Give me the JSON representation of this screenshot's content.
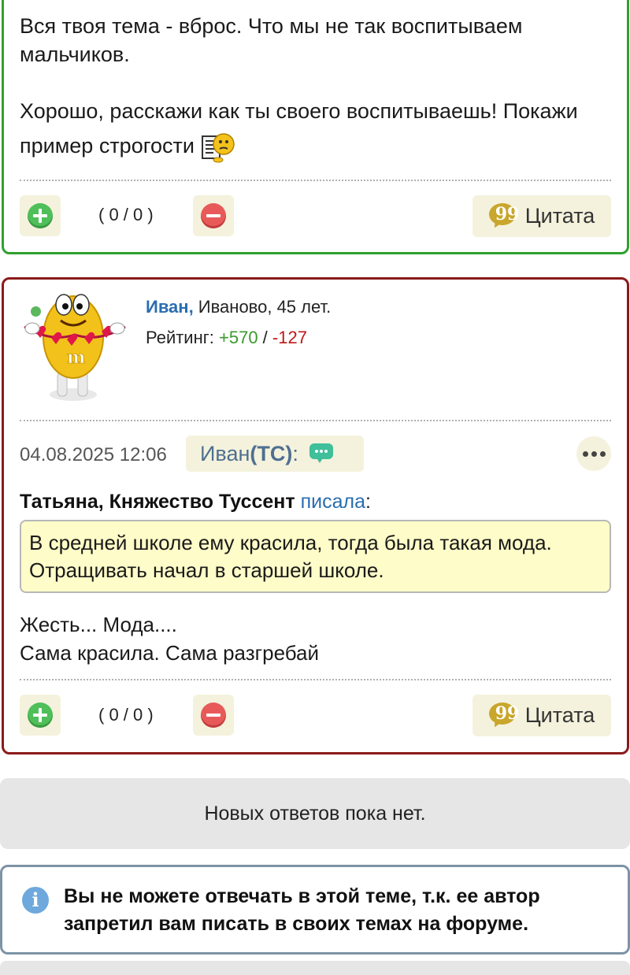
{
  "post_top": {
    "text_line1": "Вся твоя тема - вброс. Что мы не так воспитываем",
    "text_line2": "мальчиков.",
    "text_line3": "Хорошо, расскажи как ты своего воспитываешь! Покажи",
    "text_line4": "пример строгости",
    "emoji_icon": "reading-newspaper-emoji-icon",
    "votes": "( 0 / 0 )",
    "quote_label": "Цитата"
  },
  "post_ivan": {
    "author_name": "Иван,",
    "author_meta": " Иваново, 45 лет.",
    "rating_label": "Рейтинг: ",
    "rating_plus": "+570",
    "rating_sep": " / ",
    "rating_minus": "-127",
    "date": "04.08.2025 12:06",
    "chip_name": "Иван ",
    "chip_tag": "(ТС)",
    "chip_colon": ":",
    "quoted_author": "Татьяна, Княжество Туссент",
    "quoted_wrote": "писала",
    "quoted_colon": ":",
    "quote_line1": "В средней школе ему красила, тогда была такая мода.",
    "quote_line2": "Отращивать начал в старшей школе.",
    "body_line1": "Жесть... Мода....",
    "body_line2": "Сама красила. Сама разгребай",
    "votes": "( 0 / 0 )",
    "quote_label": "Цитата"
  },
  "no_replies": "Новых ответов пока нет.",
  "info": {
    "icon": "info-icon",
    "line1": "Вы не можете отвечать в этой теме, т.к. ее автор",
    "line2": "запретил вам писать в своих темах на форуме."
  },
  "colors": {
    "top_border": "#2fa02f",
    "post_border": "#8b1a1a",
    "rating_plus": "#3a9a2c",
    "rating_minus": "#c01818",
    "link": "#2a6db0",
    "quote_bg": "#fefcc8",
    "button_bg": "#f4f2dc"
  }
}
